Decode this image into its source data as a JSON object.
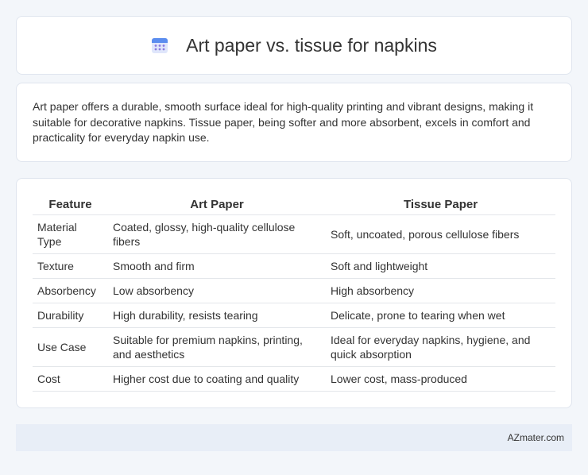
{
  "header": {
    "title": "Art paper vs. tissue for napkins",
    "icon": "calendar-icon",
    "icon_colors": {
      "top": "#5b8def",
      "body": "#c7d3f5",
      "dots": "#8a7be0"
    }
  },
  "summary": "Art paper offers a durable, smooth surface ideal for high-quality printing and vibrant designs, making it suitable for decorative napkins. Tissue paper, being softer and more absorbent, excels in comfort and practicality for everyday napkin use.",
  "table": {
    "headers": [
      "Feature",
      "Art Paper",
      "Tissue Paper"
    ],
    "rows": [
      {
        "feature": "Material Type",
        "art": "Coated, glossy, high-quality cellulose fibers",
        "tissue": "Soft, uncoated, porous cellulose fibers"
      },
      {
        "feature": "Texture",
        "art": "Smooth and firm",
        "tissue": "Soft and lightweight"
      },
      {
        "feature": "Absorbency",
        "art": "Low absorbency",
        "tissue": "High absorbency"
      },
      {
        "feature": "Durability",
        "art": "High durability, resists tearing",
        "tissue": "Delicate, prone to tearing when wet"
      },
      {
        "feature": "Use Case",
        "art": "Suitable for premium napkins, printing, and aesthetics",
        "tissue": "Ideal for everyday napkins, hygiene, and quick absorption"
      },
      {
        "feature": "Cost",
        "art": "Higher cost due to coating and quality",
        "tissue": "Lower cost, mass-produced"
      }
    ]
  },
  "footer": {
    "site": "AZmater.com"
  }
}
